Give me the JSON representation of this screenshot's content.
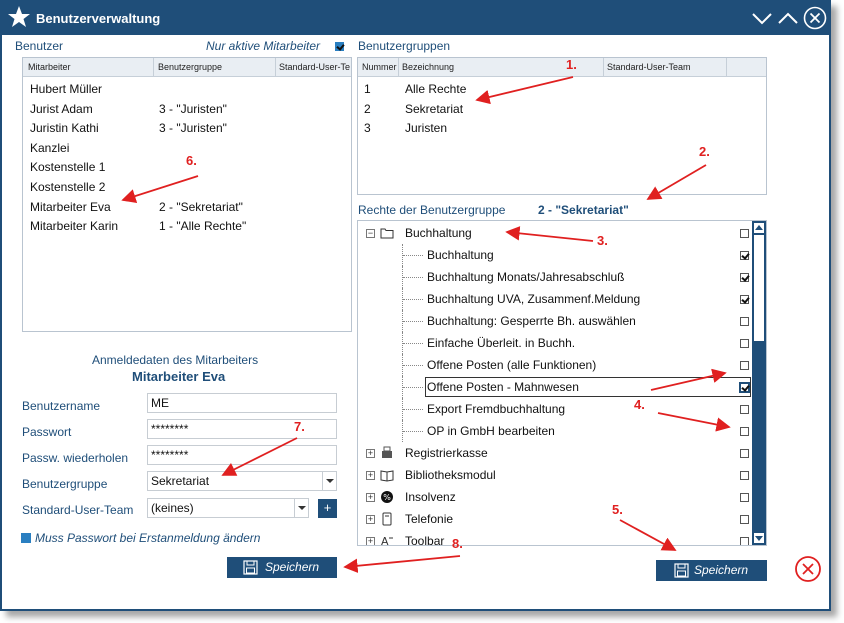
{
  "window": {
    "title": "Benutzerverwaltung"
  },
  "users_panel": {
    "label": "Benutzer",
    "filter_label": "Nur aktive Mitarbeiter",
    "columns": [
      "Mitarbeiter",
      "Benutzergruppe",
      "Standard-User-Te"
    ],
    "rows": [
      [
        "Hubert Müller",
        ""
      ],
      [
        "Jurist Adam",
        "3 - \"Juristen\""
      ],
      [
        "Juristin Kathi",
        "3 - \"Juristen\""
      ],
      [
        "Kanzlei",
        ""
      ],
      [
        "Kostenstelle 1",
        ""
      ],
      [
        "Kostenstelle 2",
        ""
      ],
      [
        "Mitarbeiter Eva",
        "2 - \"Sekretariat\""
      ],
      [
        "Mitarbeiter Karin",
        "1 - \"Alle Rechte\""
      ]
    ]
  },
  "groups_panel": {
    "label": "Benutzergruppen",
    "columns": [
      "Nummer",
      "Bezeichnung",
      "Standard-User-Team"
    ],
    "rows": [
      [
        "1",
        "Alle Rechte"
      ],
      [
        "2",
        "Sekretariat"
      ],
      [
        "3",
        "Juristen"
      ]
    ]
  },
  "rights_panel": {
    "label": "Rechte der Benutzergruppe",
    "selected_group": "2 - \"Sekretariat\"",
    "items": [
      {
        "label": "Buchhaltung",
        "checked": false
      },
      {
        "label": "Buchhaltung",
        "checked": true
      },
      {
        "label": "Buchhaltung Monats/Jahresabschluß",
        "checked": true
      },
      {
        "label": "Buchhaltung UVA, Zusammenf.Meldung",
        "checked": true
      },
      {
        "label": "Buchhaltung: Gesperrte Bh. auswählen",
        "checked": false
      },
      {
        "label": "Einfache Überleit. in Buchh.",
        "checked": false
      },
      {
        "label": "Offene Posten (alle Funktionen)",
        "checked": false
      },
      {
        "label": "Offene Posten - Mahnwesen",
        "checked": true
      },
      {
        "label": "Export Fremdbuchhaltung",
        "checked": false
      },
      {
        "label": "OP in GmbH bearbeiten",
        "checked": false
      },
      {
        "label": "Registrierkasse",
        "checked": false
      },
      {
        "label": "Bibliotheksmodul",
        "checked": false
      },
      {
        "label": "Insolvenz",
        "checked": false
      },
      {
        "label": "Telefonie",
        "checked": false
      },
      {
        "label": "Toolbar",
        "checked": false
      }
    ]
  },
  "login": {
    "heading": "Anmeldedaten des Mitarbeiters",
    "employee": "Mitarbeiter Eva",
    "username_label": "Benutzername",
    "username": "ME",
    "password_label": "Passwort",
    "password": "********",
    "password_repeat_label": "Passw. wiederholen",
    "password_repeat": "********",
    "group_label": "Benutzergruppe",
    "group": "Sekretariat",
    "team_label": "Standard-User-Team",
    "team": "(keines)",
    "must_change_label": "Muss Passwort bei Erstanmeldung ändern"
  },
  "buttons": {
    "save": "Speichern"
  },
  "annotations": [
    "1.",
    "2.",
    "3.",
    "4.",
    "5.",
    "6.",
    "7.",
    "8."
  ],
  "colors": {
    "titlebar": "#1f4e79",
    "accent": "#2a7fc1",
    "annotation": "#e02020"
  }
}
